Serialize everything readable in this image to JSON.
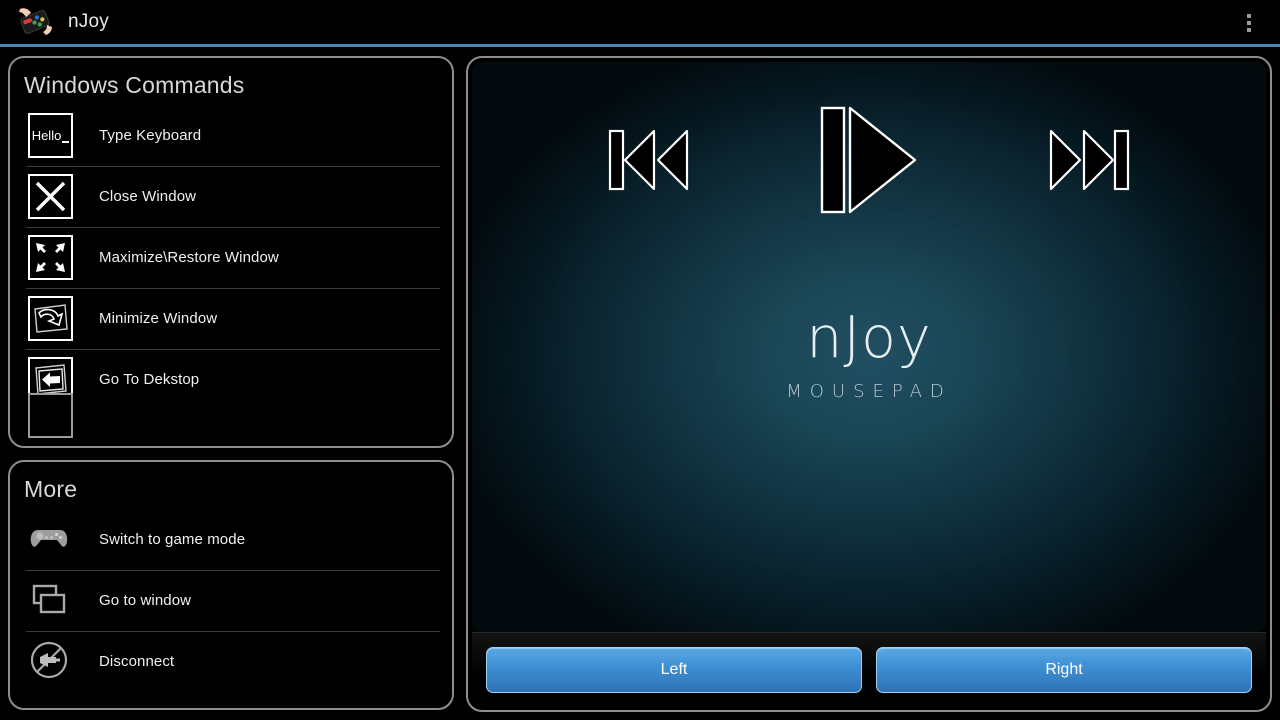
{
  "titlebar": {
    "app_name": "nJoy",
    "app_icon": "hand-holding-gamepad-icon",
    "overflow_icon": "overflow-menu-icon",
    "accent_color": "#4a87ad"
  },
  "windows_commands": {
    "title": "Windows Commands",
    "items": [
      {
        "label": "Type Keyboard",
        "icon": "keyboard-hello-icon",
        "icon_text": "Hello"
      },
      {
        "label": "Close Window",
        "icon": "close-x-icon"
      },
      {
        "label": "Maximize\\Restore Window",
        "icon": "maximize-arrows-icon"
      },
      {
        "label": "Minimize Window",
        "icon": "minimize-curved-arrow-icon"
      },
      {
        "label": "Go To Dekstop",
        "icon": "go-to-desktop-arrow-icon"
      }
    ]
  },
  "more": {
    "title": "More",
    "items": [
      {
        "label": "Switch to game mode",
        "icon": "gamepad-icon"
      },
      {
        "label": "Go to window",
        "icon": "windows-stack-icon"
      },
      {
        "label": "Disconnect",
        "icon": "disconnect-plug-icon"
      }
    ]
  },
  "mousepad": {
    "brand_name": "nJoy",
    "brand_sub": "MOUSEPAD",
    "media_controls": [
      {
        "name": "previous-track",
        "icon": "skip-previous-icon"
      },
      {
        "name": "play-pause",
        "icon": "play-pause-icon"
      },
      {
        "name": "next-track",
        "icon": "skip-next-icon"
      }
    ],
    "buttons": {
      "left": "Left",
      "right": "Right",
      "accent_color": "#3d8ed2"
    }
  }
}
